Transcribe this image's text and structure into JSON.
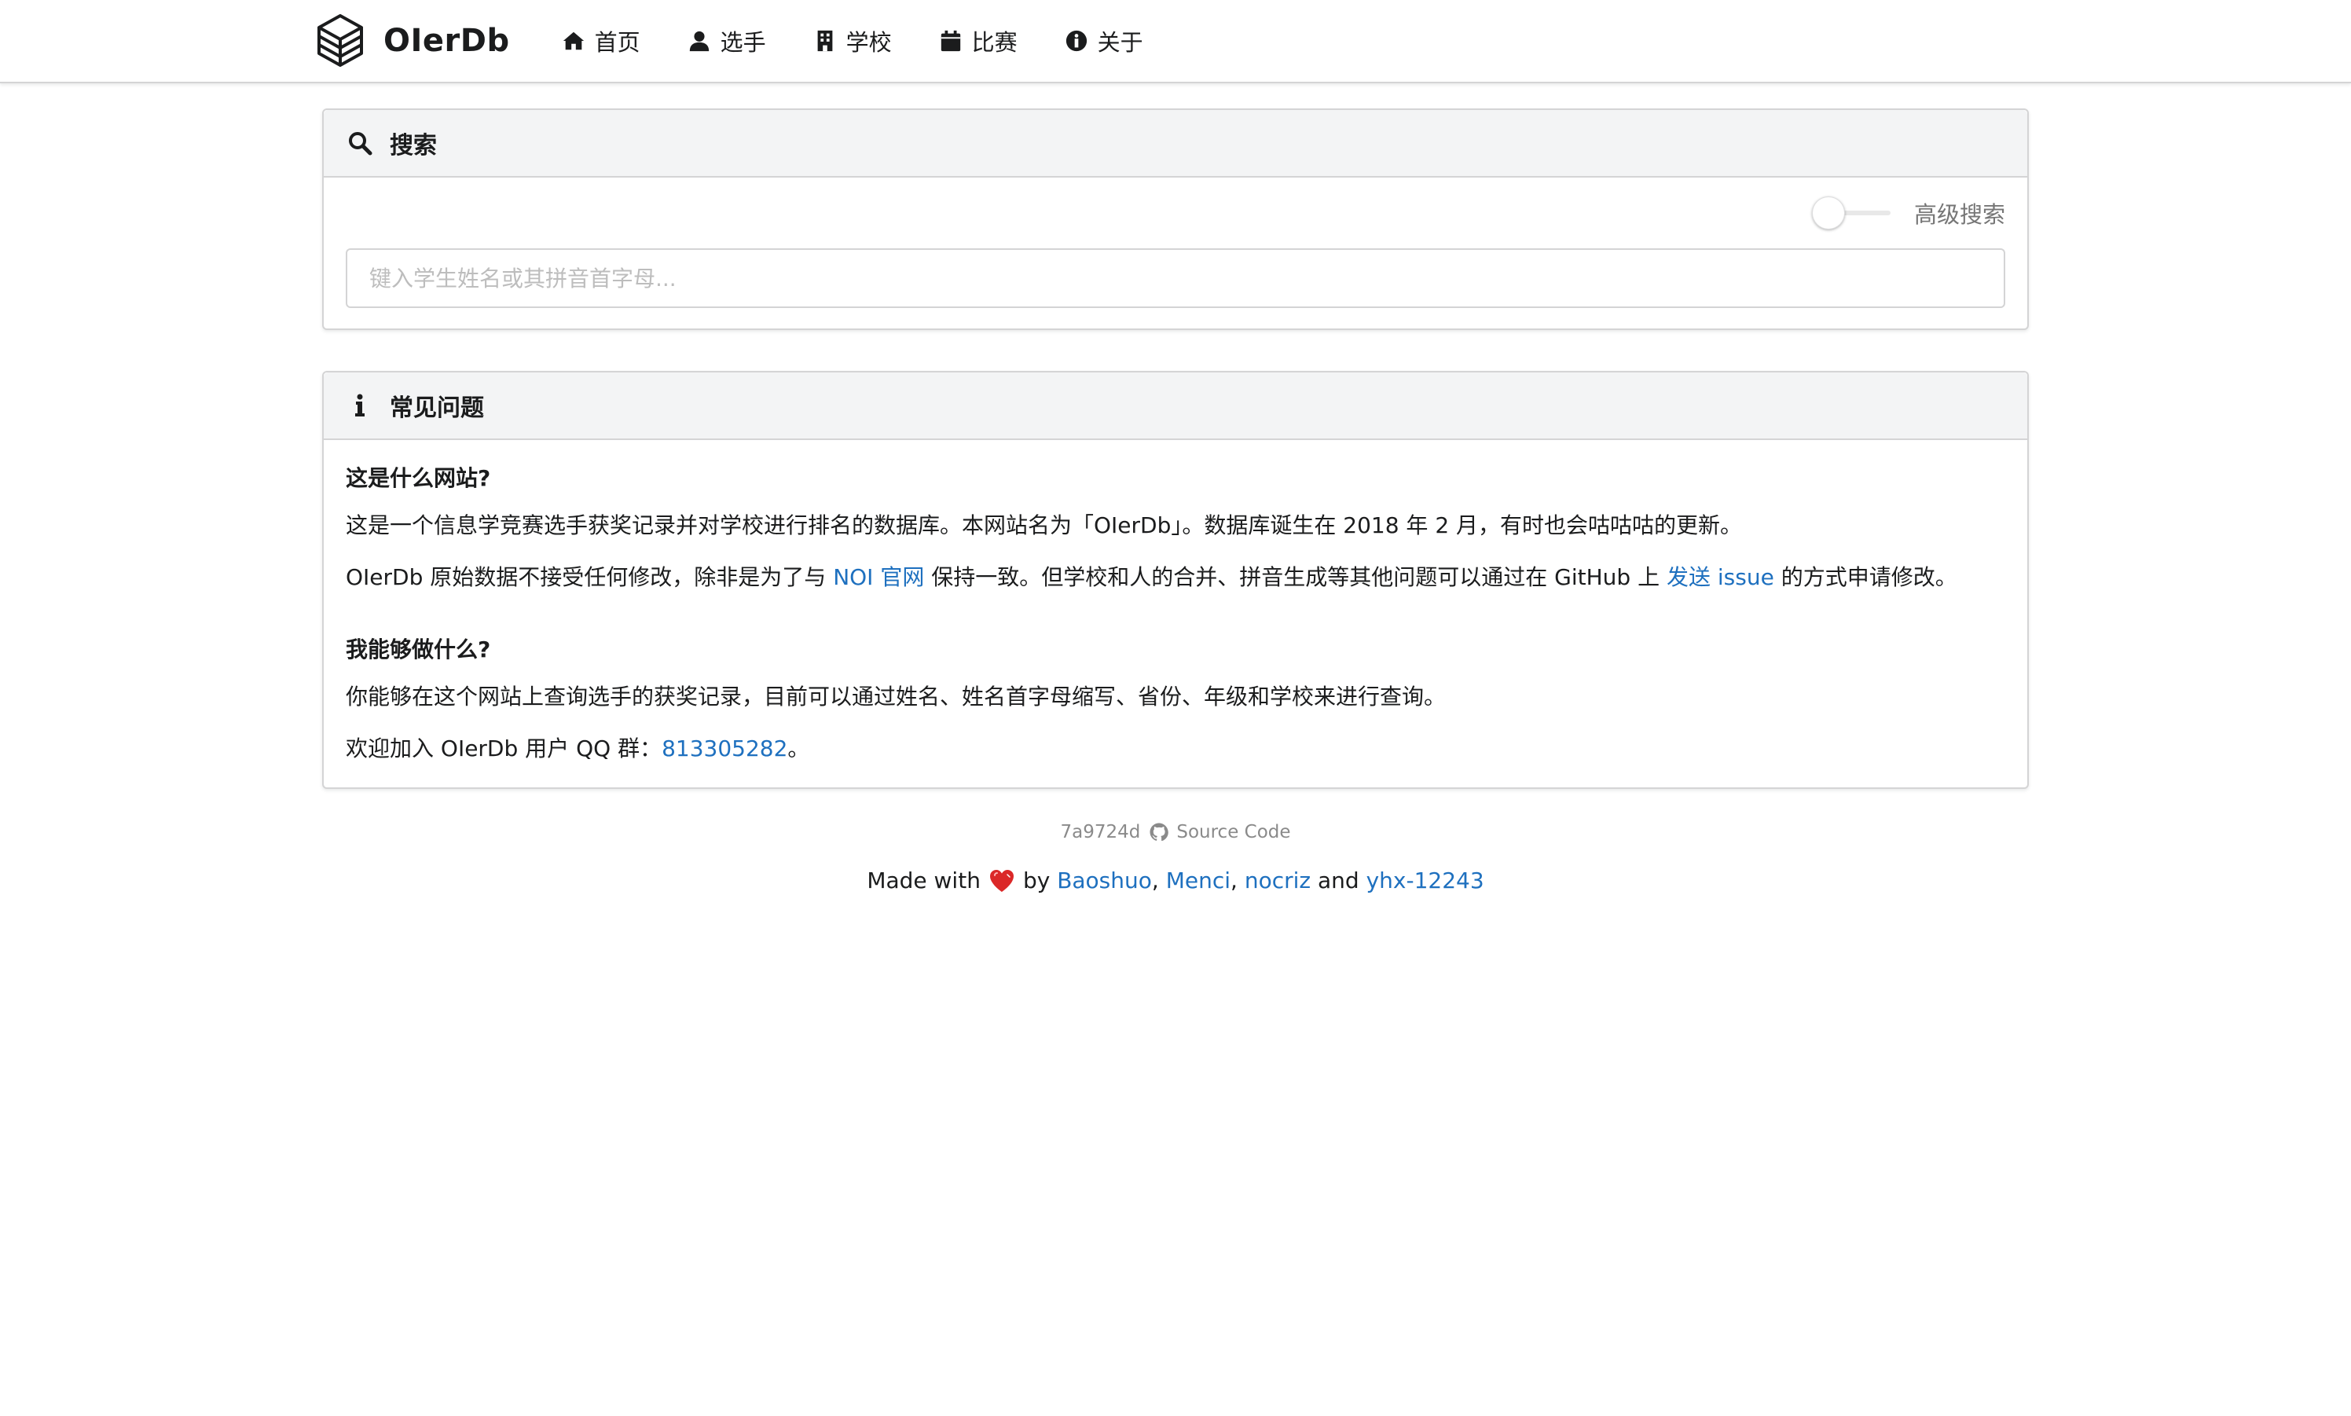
{
  "app": {
    "brand": "OIerDb"
  },
  "nav": [
    {
      "label": "首页",
      "icon": "home-icon"
    },
    {
      "label": "选手",
      "icon": "user-icon"
    },
    {
      "label": "学校",
      "icon": "building-icon"
    },
    {
      "label": "比赛",
      "icon": "calendar-icon"
    },
    {
      "label": "关于",
      "icon": "info-circle-icon"
    }
  ],
  "search": {
    "title": "搜索",
    "advanced_label": "高级搜索",
    "advanced_enabled": false,
    "placeholder": "键入学生姓名或其拼音首字母...",
    "value": ""
  },
  "faq": {
    "title": "常见问题",
    "q1": "这是什么网站?",
    "a1": "这是一个信息学竞赛选手获奖记录并对学校进行排名的数据库。本网站名为「OIerDb」。数据库诞生在 2018 年 2 月，有时也会咕咕咕的更新。",
    "a2_pre": "OIerDb 原始数据不接受任何修改，除非是为了与 ",
    "a2_link1": "NOI 官网",
    "a2_mid": " 保持一致。但学校和人的合并、拼音生成等其他问题可以通过在 GitHub 上 ",
    "a2_link2": "发送 issue",
    "a2_post": " 的方式申请修改。",
    "q2": "我能够做什么?",
    "a3": "你能够在这个网站上查询选手的获奖记录，目前可以通过姓名、姓名首字母缩写、省份、年级和学校来进行查询。",
    "a4_pre": "欢迎加入 OIerDb 用户 QQ 群：",
    "a4_link": "813305282",
    "a4_post": "。"
  },
  "footer": {
    "commit": "7a9724d",
    "source_label": "Source Code",
    "made_with": "Made with",
    "by": "by",
    "authors": [
      "Baoshuo",
      "Menci",
      "nocriz",
      "yhx-12243"
    ],
    "sep": ",",
    "and": "and"
  },
  "colors": {
    "link": "#1e70bf",
    "heart": "#db2828"
  }
}
